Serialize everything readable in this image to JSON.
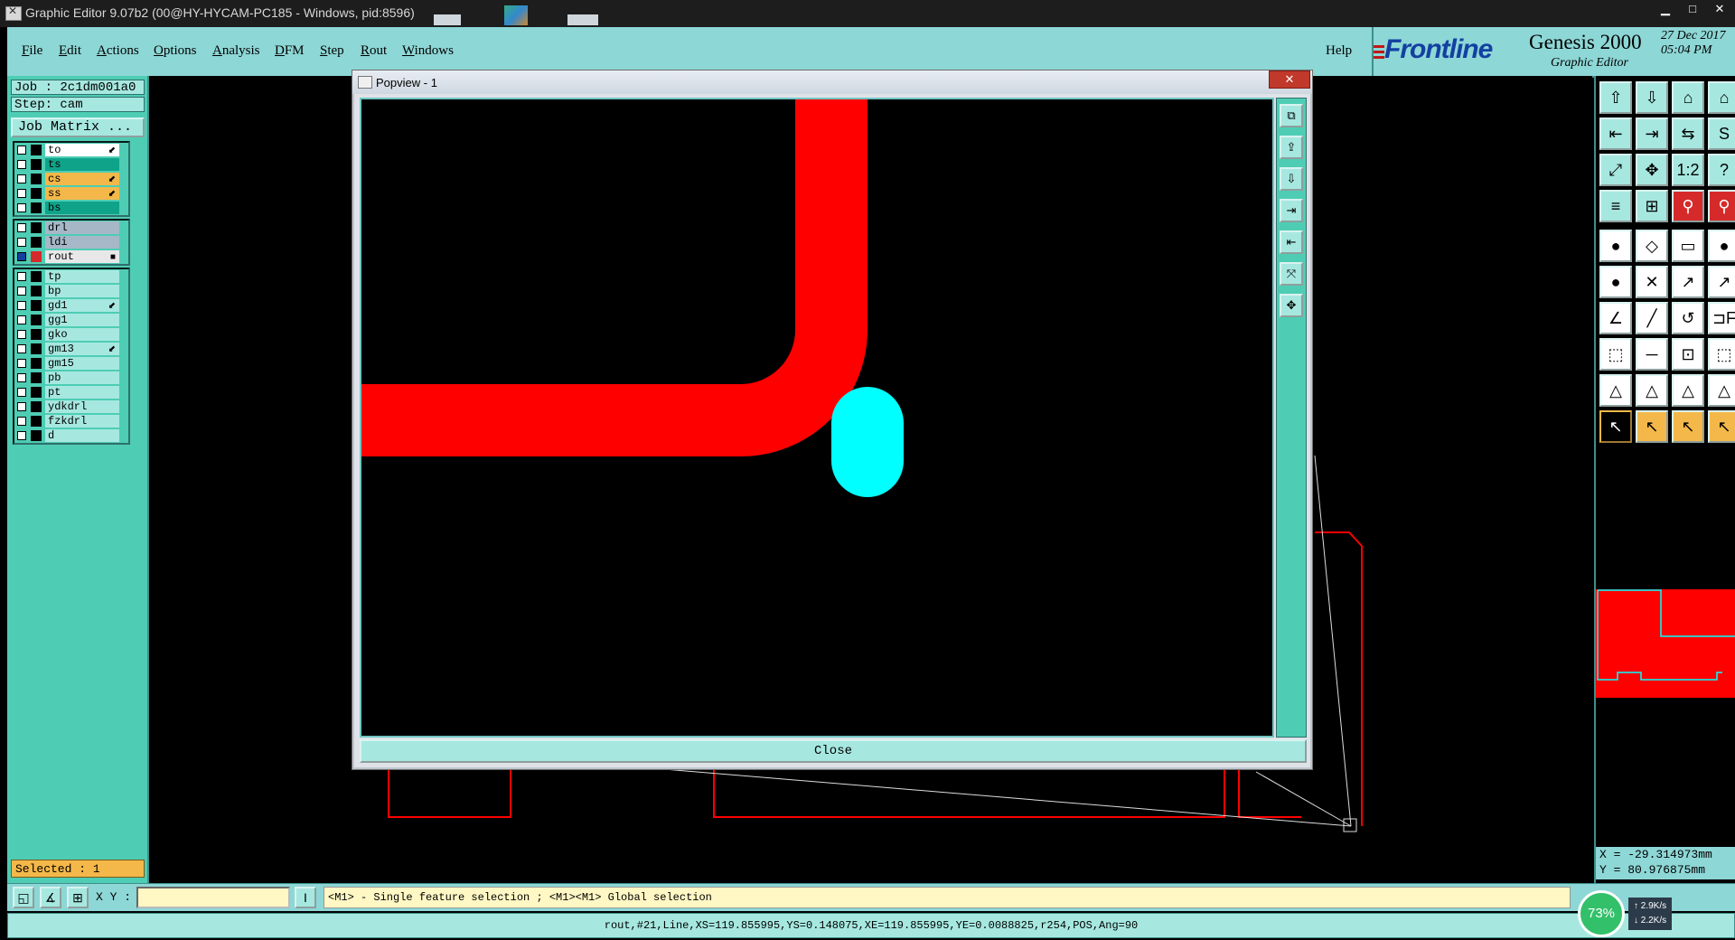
{
  "os_window": {
    "title": "Graphic Editor 9.07b2 (00@HY-HYCAM-PC185 - Windows, pid:8596)",
    "minimize": "▁",
    "maximize": "□",
    "close": "✕"
  },
  "menu": {
    "items": [
      {
        "name": "File",
        "underline": "F",
        "rest": "ile"
      },
      {
        "name": "Edit",
        "underline": "E",
        "rest": "dit"
      },
      {
        "name": "Actions",
        "underline": "A",
        "rest": "ctions"
      },
      {
        "name": "Options",
        "underline": "O",
        "rest": "ptions"
      },
      {
        "name": "Analysis",
        "underline": "A",
        "rest": "nalysis"
      },
      {
        "name": "DFM",
        "underline": "D",
        "rest": "FM"
      },
      {
        "name": "Step",
        "underline": "S",
        "rest": "tep"
      },
      {
        "name": "Rout",
        "underline": "R",
        "rest": "out"
      },
      {
        "name": "Windows",
        "underline": "W",
        "rest": "indows"
      }
    ],
    "help": "Help"
  },
  "brand": {
    "logo": "Frontline",
    "product": "Genesis 2000",
    "subtitle": "Graphic Editor",
    "date": "27 Dec 2017",
    "time": "05:04 PM"
  },
  "left_panel": {
    "job": "Job : 2c1dm001a0",
    "step": "Step: cam",
    "job_matrix": "Job Matrix ...",
    "groups": [
      [
        {
          "name": "to",
          "color": "#ffffff",
          "mark": "⬋"
        },
        {
          "name": "ts",
          "color": "#0fa38a",
          "mark": ""
        },
        {
          "name": "cs",
          "color": "#f4b84a",
          "mark": "⬋"
        },
        {
          "name": "ss",
          "color": "#f4b84a",
          "mark": "⬋"
        },
        {
          "name": "bs",
          "color": "#0fa38a",
          "mark": ""
        }
      ],
      [
        {
          "name": "drl",
          "color": "#a6b8c8",
          "mark": ""
        },
        {
          "name": "ldi",
          "color": "#a6b8c8",
          "mark": ""
        },
        {
          "name": "rout",
          "color": "#e8e8e8",
          "mark": "■",
          "active": true
        }
      ],
      [
        {
          "name": "tp",
          "color": "#a6e8e0",
          "mark": ""
        },
        {
          "name": "bp",
          "color": "#a6e8e0",
          "mark": ""
        },
        {
          "name": "gd1",
          "color": "#a6e8e0",
          "mark": "⬋"
        },
        {
          "name": "gg1",
          "color": "#a6e8e0",
          "mark": ""
        },
        {
          "name": "gko",
          "color": "#a6e8e0",
          "mark": ""
        },
        {
          "name": "gm13",
          "color": "#a6e8e0",
          "mark": "⬋"
        },
        {
          "name": "gm15",
          "color": "#a6e8e0",
          "mark": ""
        },
        {
          "name": "pb",
          "color": "#a6e8e0",
          "mark": ""
        },
        {
          "name": "pt",
          "color": "#a6e8e0",
          "mark": ""
        },
        {
          "name": "ydkdrl",
          "color": "#a6e8e0",
          "mark": ""
        },
        {
          "name": "fzkdrl",
          "color": "#a6e8e0",
          "mark": ""
        },
        {
          "name": "d",
          "color": "#a6e8e0",
          "mark": ""
        }
      ]
    ],
    "selected": "Selected : 1"
  },
  "popview": {
    "title": "Popview - 1",
    "close_x": "✕",
    "close_button": "Close",
    "tools": [
      "⧉",
      "⇪",
      "⇩",
      "⇥",
      "⇤",
      "⤧",
      "✥"
    ]
  },
  "right_panel": {
    "rows": [
      [
        "⇧",
        "⇩",
        "⌂",
        "⌂"
      ],
      [
        "⇤",
        "⇥",
        "⇆",
        "S"
      ],
      [
        "⤢",
        "✥",
        "1:2",
        "?"
      ],
      [
        "≡",
        "⊞",
        "⚲",
        "⚲"
      ],
      [
        "●",
        "◇",
        "▭",
        "●"
      ],
      [
        "●",
        "✕",
        "↗",
        "↗"
      ],
      [
        "∠",
        "╱",
        "↺",
        "⊐F"
      ],
      [
        "⬚",
        "─",
        "⊡",
        "⬚"
      ],
      [
        "△",
        "△",
        "△",
        "△"
      ],
      [
        "↖",
        "↖",
        "↖",
        "↖"
      ]
    ],
    "coord_x": "X = -29.314973mm",
    "coord_y": "Y = 80.976875mm"
  },
  "command_bar": {
    "xy_label": "X Y :",
    "xy_value": "",
    "hint": "<M1> - Single feature selection ; <M1><M1> Global selection"
  },
  "status_line": "rout,#21,Line,XS=119.855995,YS=0.148075,XE=119.855995,YE=0.0088825,r254,POS,Ang=90",
  "net_widget": {
    "percent": "73%",
    "up": "2.9K/s",
    "down": "2.2K/s"
  },
  "colors": {
    "panel_teal": "#4ecdb4",
    "menubar": "#8dd7d6",
    "feature_red": "#ff0000",
    "highlight_cyan": "#00ffff",
    "selected_orange": "#f4b84a"
  }
}
